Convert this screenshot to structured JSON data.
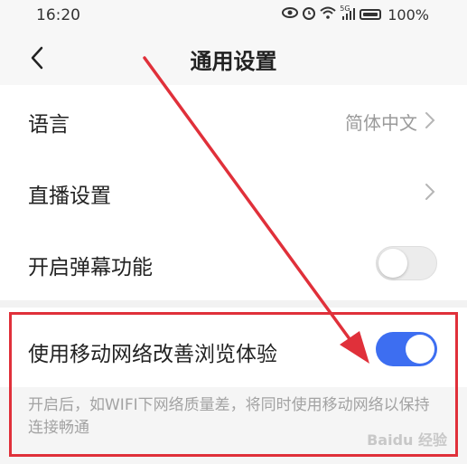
{
  "status_bar": {
    "time": "16:20",
    "icons": [
      "eye-icon",
      "alarm-icon",
      "wifi-icon",
      "signal-icon",
      "battery-icon"
    ],
    "signal_label": "5G",
    "battery": "100%"
  },
  "header": {
    "title": "通用设置",
    "back_icon": "chevron-left-icon"
  },
  "settings": {
    "language": {
      "label": "语言",
      "value": "简体中文"
    },
    "live": {
      "label": "直播设置"
    },
    "danmaku": {
      "label": "开启弹幕功能",
      "enabled": false
    },
    "mobile_network": {
      "label": "使用移动网络改善浏览体验",
      "enabled": true,
      "hint": "开启后，如WIFI下网络质量差，将同时使用移动网络以保持连接畅通"
    }
  },
  "watermark": "Baidu 经验",
  "colors": {
    "accent": "#3d6ef1",
    "annotation": "#e0303a",
    "background": "#f2f2f2"
  }
}
